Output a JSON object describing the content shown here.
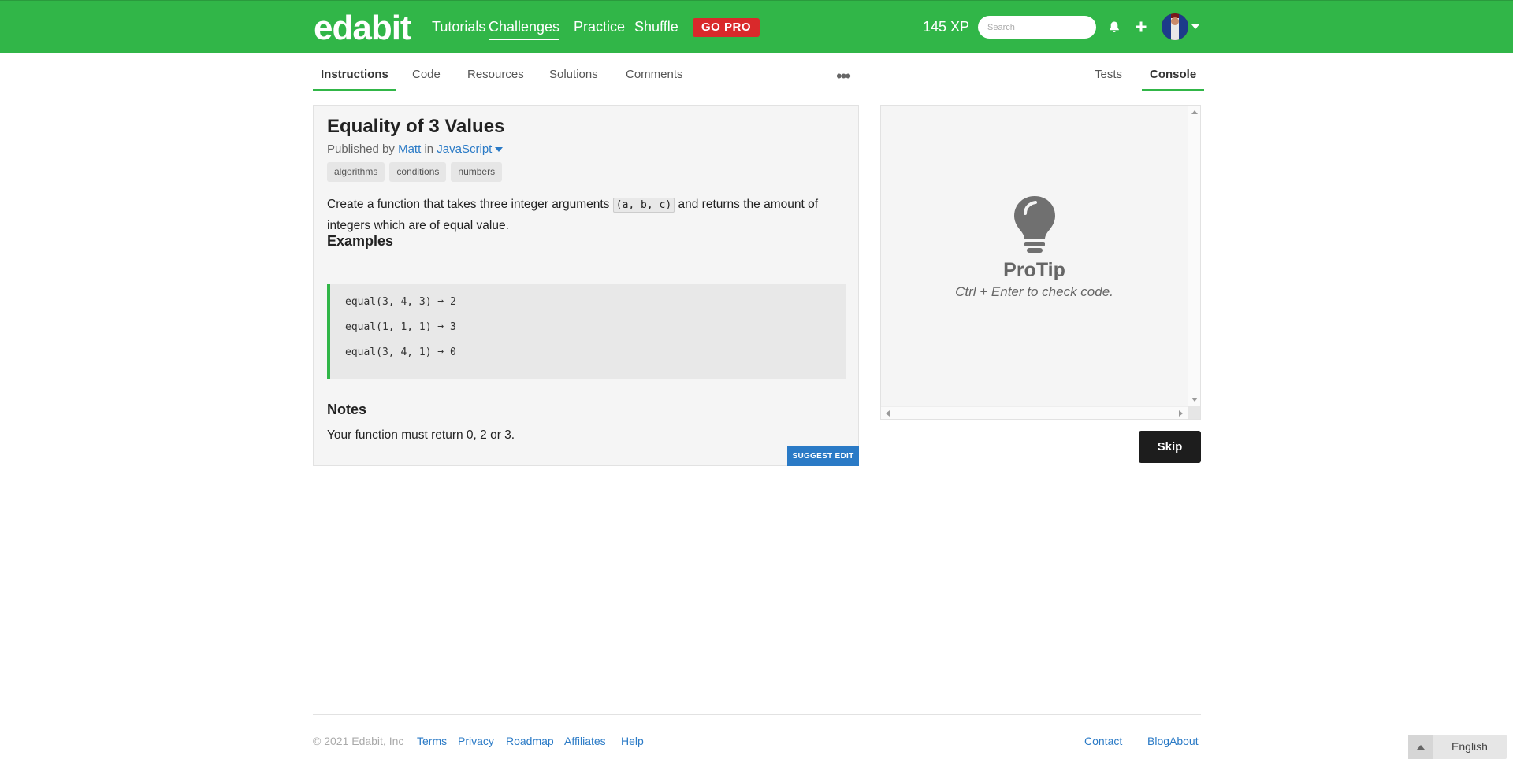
{
  "header": {
    "logo": "edabit",
    "nav": [
      "Tutorials",
      "Challenges",
      "Practice",
      "Shuffle"
    ],
    "active_nav": "Challenges",
    "gopro": "GO PRO",
    "xp": "145 XP",
    "search_placeholder": "Search",
    "accent_color": "#31b648"
  },
  "tabs": {
    "left": [
      "Instructions",
      "Code",
      "Resources",
      "Solutions",
      "Comments"
    ],
    "right": [
      "Tests",
      "Console"
    ],
    "active_left": "Instructions",
    "active_right": "Console"
  },
  "challenge": {
    "title": "Equality of 3 Values",
    "published_by_prefix": "Published by",
    "author": "Matt",
    "in_word": "in",
    "language": "JavaScript",
    "tags": [
      "algorithms",
      "conditions",
      "numbers"
    ],
    "desc_before": "Create a function that takes three integer arguments",
    "desc_code": "(a, b, c)",
    "desc_after": "and returns the amount of integers which are of equal value.",
    "examples_heading": "Examples",
    "examples": [
      "equal(3, 4, 3) ➞ 2",
      "equal(1, 1, 1) ➞ 3",
      "equal(3, 4, 1) ➞ 0"
    ],
    "notes_heading": "Notes",
    "notes_text": "Your function must return 0, 2 or 3.",
    "suggest_edit": "SUGGEST EDIT"
  },
  "console": {
    "protip_title": "ProTip",
    "protip_text": "Ctrl + Enter to check code.",
    "skip": "Skip"
  },
  "footer": {
    "copyright": "© 2021 Edabit, Inc",
    "left_links": [
      "Terms",
      "Privacy",
      "Roadmap",
      "Affiliates",
      "Help"
    ],
    "right_links": [
      "Contact",
      "Blog",
      "About"
    ],
    "language": "English"
  }
}
